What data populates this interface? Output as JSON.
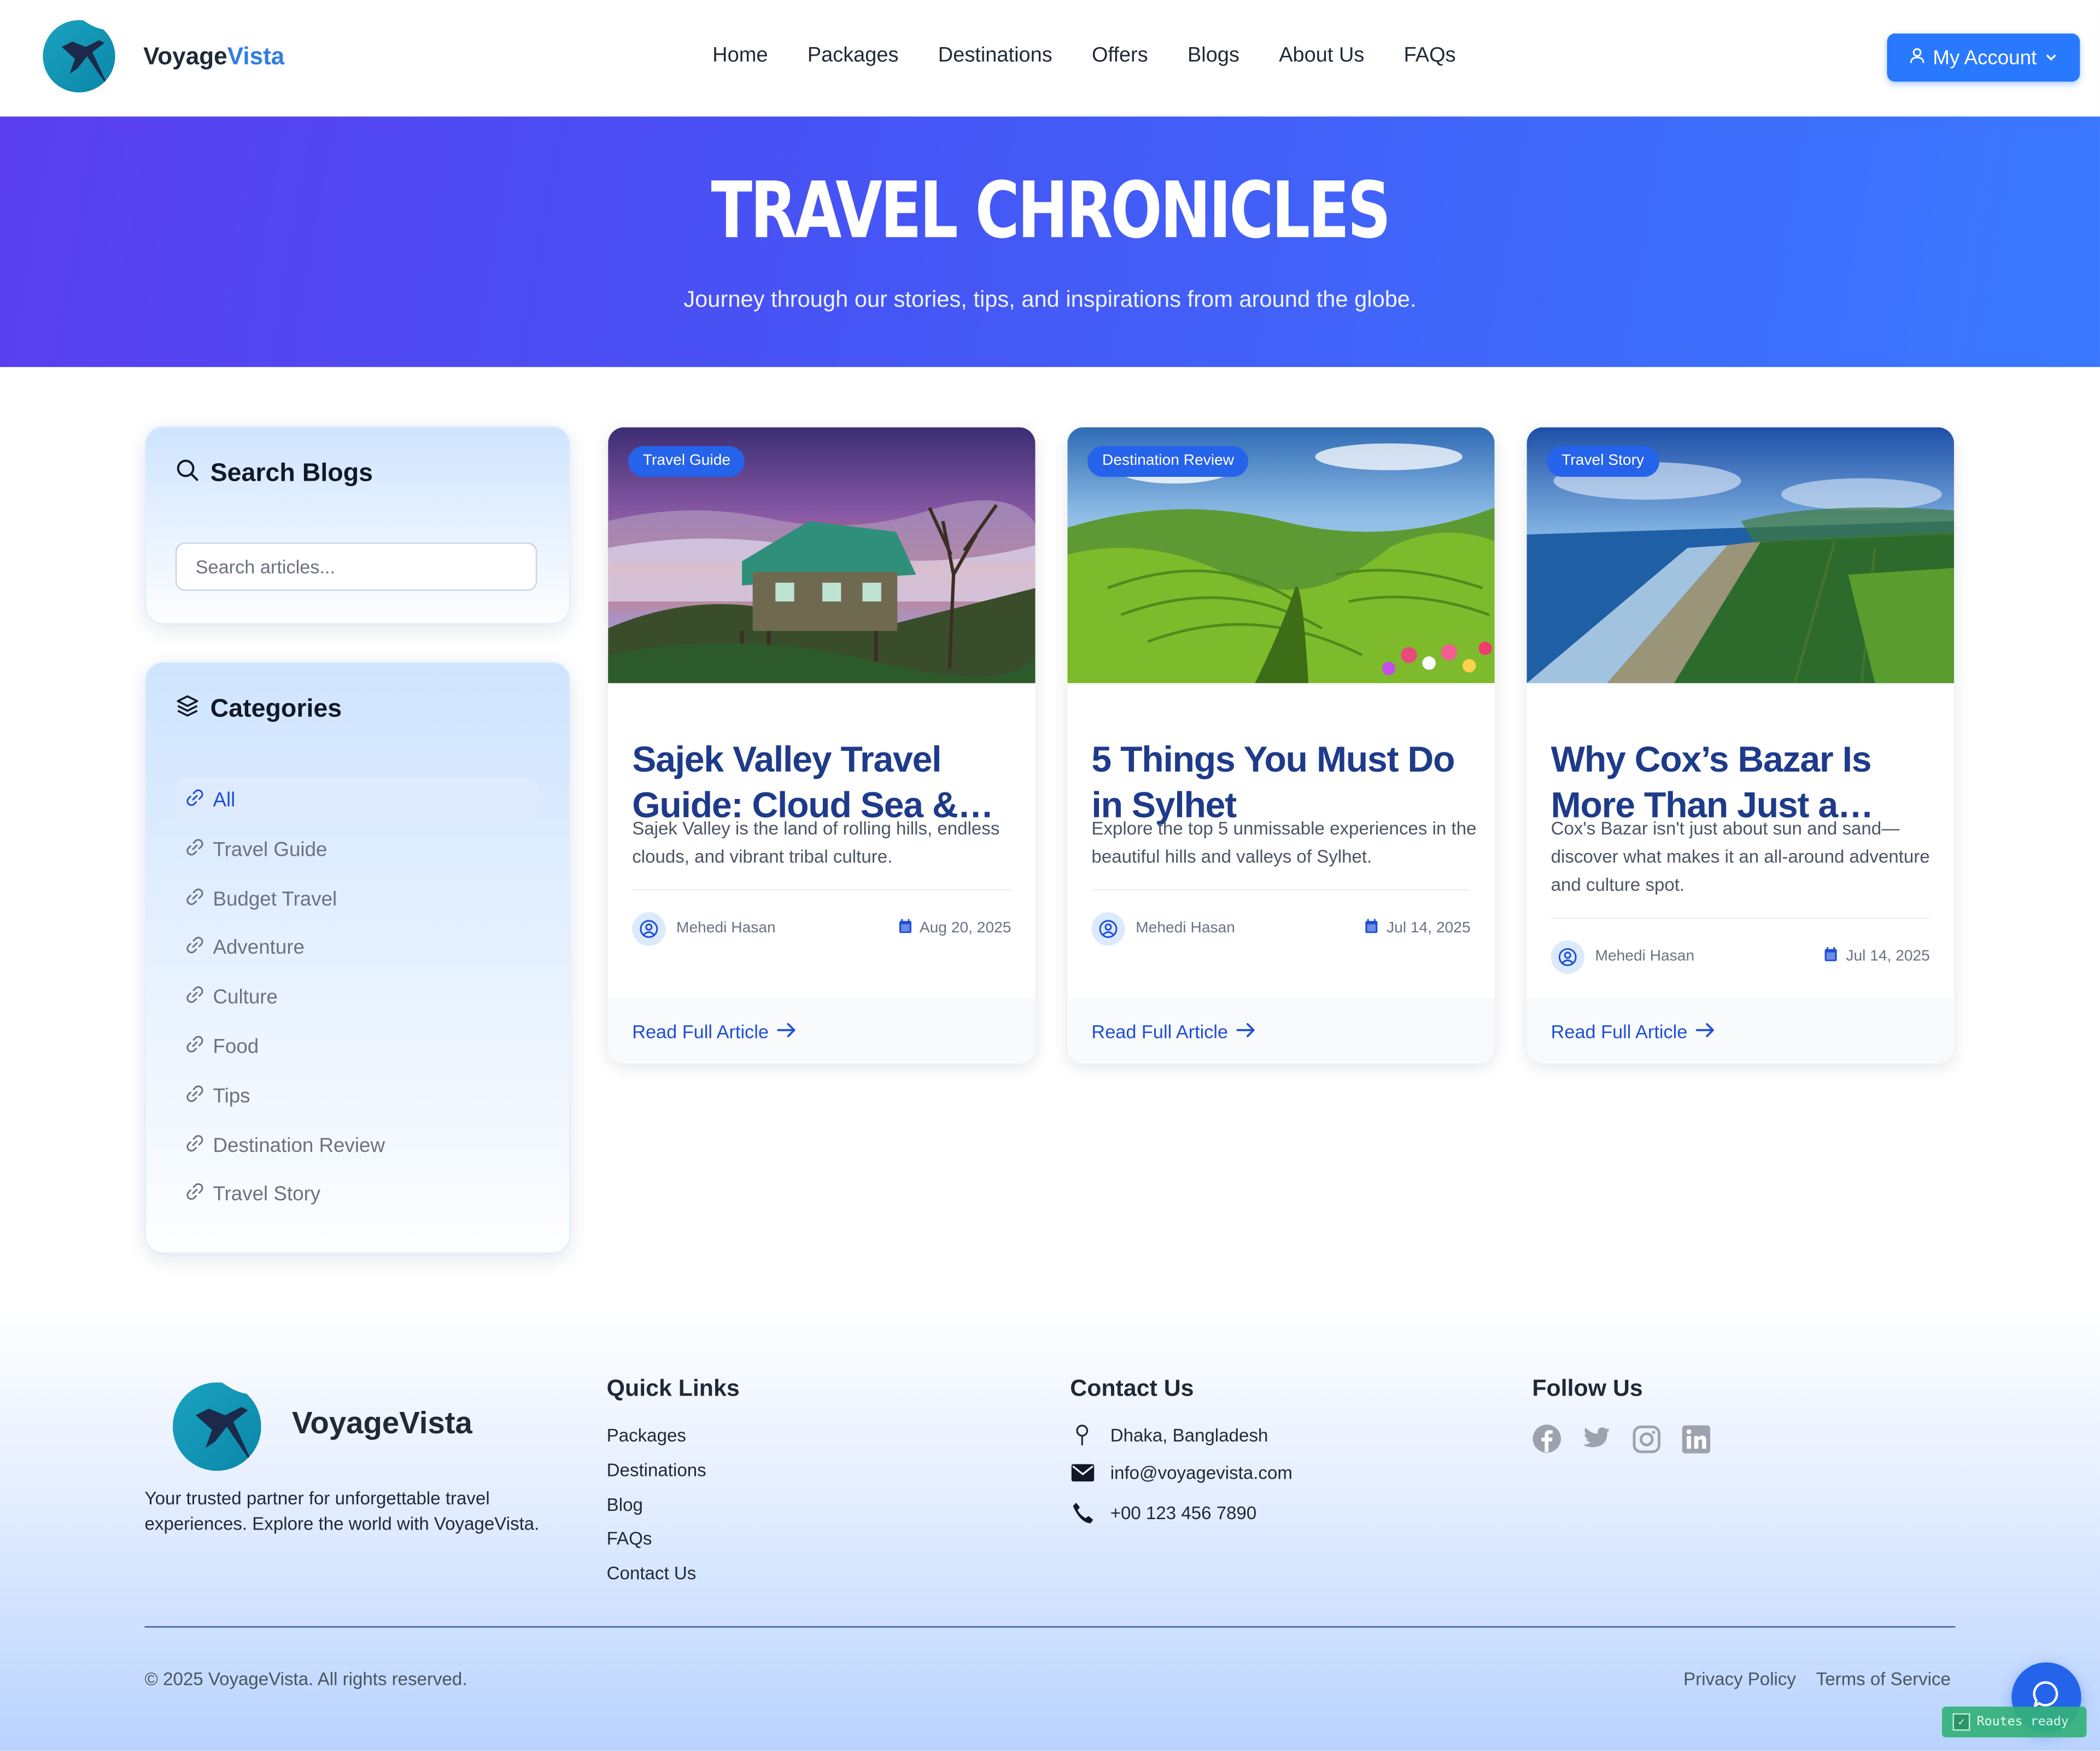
{
  "navbar": {
    "brand_main": "Voyage",
    "brand_accent": "Vista",
    "links": [
      "Home",
      "Packages",
      "Destinations",
      "Offers",
      "Blogs",
      "About Us",
      "FAQs"
    ],
    "account_label": "My Account"
  },
  "hero": {
    "title": "TRAVEL CHRONICLES",
    "subtitle": "Journey through our stories, tips, and inspirations from around the globe."
  },
  "sidebar": {
    "search_title": "Search Blogs",
    "search_placeholder": "Search articles...",
    "categories_title": "Categories",
    "categories": [
      "All",
      "Travel Guide",
      "Budget Travel",
      "Adventure",
      "Culture",
      "Food",
      "Tips",
      "Destination Review",
      "Travel Story"
    ],
    "active_category": "All"
  },
  "posts": [
    {
      "badge": "Travel Guide",
      "title": "Sajek Valley Travel Guide: Cloud Sea & Tribal Culture",
      "excerpt": "Sajek Valley is the land of rolling hills, endless clouds, and vibrant tribal culture.",
      "author": "Mehedi Hasan",
      "date": "Aug 20, 2025",
      "read_label": "Read Full Article"
    },
    {
      "badge": "Destination Review",
      "title": "5 Things You Must Do in Sylhet",
      "excerpt": "Explore the top 5 unmissable experiences in the beautiful hills and valleys of Sylhet.",
      "author": "Mehedi Hasan",
      "date": "Jul 14, 2025",
      "read_label": "Read Full Article"
    },
    {
      "badge": "Travel Story",
      "title": "Why Cox’s Bazar Is More Than Just a Beach",
      "excerpt": "Cox's Bazar isn't just about sun and sand—discover what makes it an all-around adventure and culture spot.",
      "author": "Mehedi Hasan",
      "date": "Jul 14, 2025",
      "read_label": "Read Full Article"
    }
  ],
  "footer": {
    "brand": "VoyageVista",
    "description": "Your trusted partner for unforgettable travel experiences. Explore the world with VoyageVista.",
    "quick_links_title": "Quick Links",
    "quick_links": [
      "Packages",
      "Destinations",
      "Blog",
      "FAQs",
      "Contact Us"
    ],
    "contact_title": "Contact Us",
    "address": "Dhaka, Bangladesh",
    "email": "info@voyagevista.com",
    "phone": "+00 123 456 7890",
    "follow_title": "Follow Us",
    "social_icons": [
      "facebook-icon",
      "twitter-icon",
      "instagram-icon",
      "linkedin-icon"
    ],
    "copyright": "© 2025 VoyageVista. All rights reserved.",
    "privacy": "Privacy Policy",
    "terms": "Terms of Service"
  },
  "dev_badge": "Routes ready",
  "colors": {
    "primary": "#2563eb",
    "account_button": "#2979ff",
    "title_navy": "#1e3a8a",
    "hero_start": "#5b3ef0",
    "hero_end": "#3a79ff"
  }
}
